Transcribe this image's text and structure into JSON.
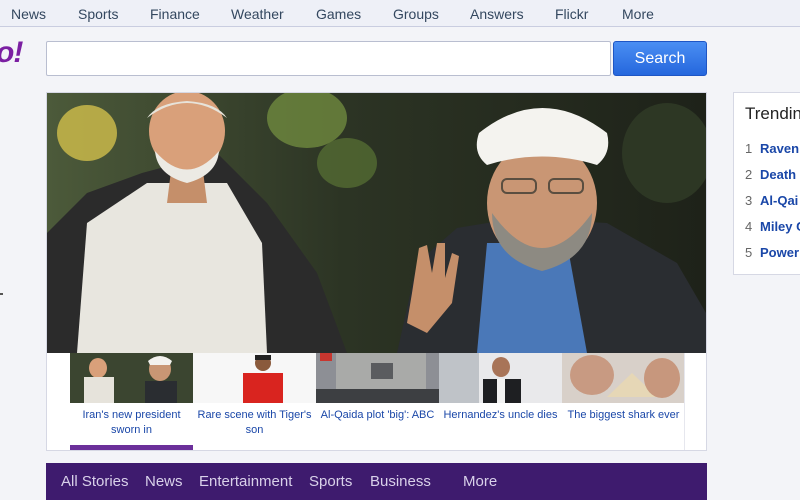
{
  "topnav": {
    "items": [
      {
        "label": "News"
      },
      {
        "label": "Sports"
      },
      {
        "label": "Finance"
      },
      {
        "label": "Weather"
      },
      {
        "label": "Games"
      },
      {
        "label": "Groups"
      },
      {
        "label": "Answers"
      },
      {
        "label": "Flickr"
      },
      {
        "label": "More"
      }
    ]
  },
  "logo": {
    "text": "o!"
  },
  "search": {
    "value": "",
    "placeholder": "",
    "button_label": "Search"
  },
  "featured": {
    "thumbs": [
      {
        "caption": "Iran's new president sworn in",
        "active": true
      },
      {
        "caption": "Rare scene with Tiger's son",
        "active": false
      },
      {
        "caption": "Al-Qaida plot 'big': ABC",
        "active": false
      },
      {
        "caption": "Hernandez's uncle dies",
        "active": false
      },
      {
        "caption": "The biggest shark ever",
        "active": false
      }
    ]
  },
  "trending": {
    "title": "Trendin",
    "items": [
      {
        "num": "1",
        "label": "Raven"
      },
      {
        "num": "2",
        "label": "Death"
      },
      {
        "num": "3",
        "label": "Al-Qai"
      },
      {
        "num": "4",
        "label": "Miley C"
      },
      {
        "num": "5",
        "label": "Power"
      }
    ]
  },
  "storybar": {
    "items": [
      {
        "label": "All Stories"
      },
      {
        "label": "News"
      },
      {
        "label": "Entertainment"
      },
      {
        "label": "Sports"
      },
      {
        "label": "Business"
      },
      {
        "label": "More"
      }
    ]
  },
  "colors": {
    "accent_purple": "#3e1b6e",
    "search_blue": "#2567dd",
    "link_blue": "#1a47a8"
  }
}
